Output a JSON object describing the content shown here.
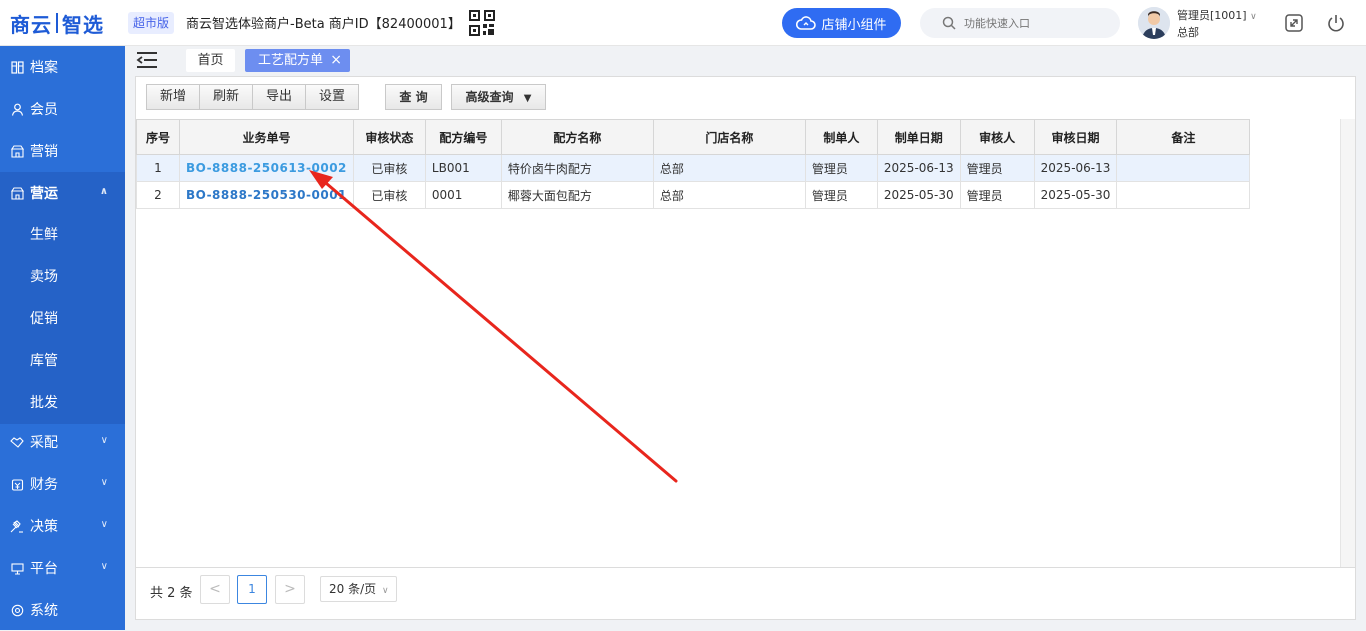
{
  "header": {
    "logo_left": "商云",
    "logo_right": "智选",
    "edition": "超市版",
    "merchant": "商云智选体验商户-Beta   商户ID【82400001】",
    "widget_label": "店铺小组件",
    "search_placeholder": "功能快速入口",
    "user_name": "管理员[1001]",
    "user_org": "总部"
  },
  "sidebar": {
    "items": [
      {
        "label": "档案",
        "icon": "archive-icon"
      },
      {
        "label": "会员",
        "icon": "user-icon"
      },
      {
        "label": "营销",
        "icon": "store-icon"
      },
      {
        "label": "营运",
        "icon": "store-icon"
      },
      {
        "label": "采配",
        "icon": "handshake-icon"
      },
      {
        "label": "财务",
        "icon": "wallet-icon"
      },
      {
        "label": "决策",
        "icon": "gavel-icon"
      },
      {
        "label": "平台",
        "icon": "monitor-icon"
      },
      {
        "label": "系统",
        "icon": "settings-icon"
      }
    ],
    "sub_items": [
      "生鲜",
      "卖场",
      "促销",
      "库管",
      "批发"
    ]
  },
  "tabs": {
    "home": "首页",
    "active": "工艺配方单"
  },
  "toolbar": {
    "buttons": [
      "新增",
      "刷新",
      "导出",
      "设置"
    ],
    "query": "查 询",
    "advanced_query": "高级查询"
  },
  "table": {
    "columns": [
      "序号",
      "业务单号",
      "审核状态",
      "配方编号",
      "配方名称",
      "门店名称",
      "制单人",
      "制单日期",
      "审核人",
      "审核日期",
      "备注"
    ],
    "rows": [
      [
        "1",
        "BO-8888-250613-0002",
        "已审核",
        "LB001",
        "特价卤牛肉配方",
        "总部",
        "管理员",
        "2025-06-13",
        "管理员",
        "2025-06-13",
        ""
      ],
      [
        "2",
        "BO-8888-250530-0001",
        "已审核",
        "0001",
        "椰蓉大面包配方",
        "总部",
        "管理员",
        "2025-05-30",
        "管理员",
        "2025-05-30",
        ""
      ]
    ]
  },
  "pagination": {
    "total": "共 2 条",
    "prev": "<",
    "current": "1",
    "next": ">",
    "page_size": "20 条/页"
  },
  "colors": {
    "sidebar": "#2b6fd8",
    "accent": "#2f6cf2",
    "link": "#2d78c8",
    "annotation_arrow": "#e8261d"
  }
}
